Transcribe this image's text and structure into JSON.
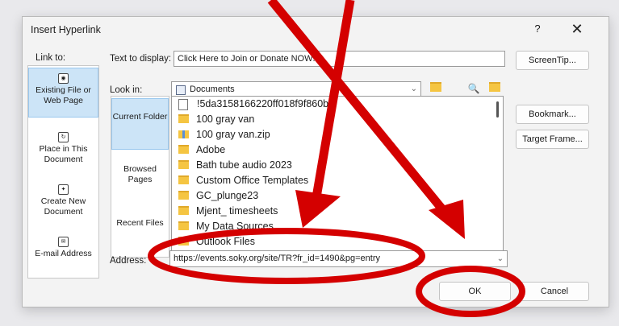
{
  "dialog": {
    "title": "Insert Hyperlink",
    "help": "?",
    "close": "✕"
  },
  "link_to": {
    "label": "Link to:",
    "items": [
      {
        "label": "Existing File or Web Page",
        "selected": true
      },
      {
        "label": "Place in This Document"
      },
      {
        "label": "Create New Document"
      },
      {
        "label": "E-mail Address"
      }
    ]
  },
  "text_to_display": {
    "label": "Text to display:",
    "value": "Click Here to Join or Donate NOW!"
  },
  "look_in": {
    "label": "Look in:",
    "value": "Documents"
  },
  "places": [
    {
      "label": "Current Folder",
      "selected": true
    },
    {
      "label": "Browsed Pages"
    },
    {
      "label": "Recent Files"
    }
  ],
  "files": [
    {
      "name": "!5da3158166220ff018f9f860b",
      "type": "file"
    },
    {
      "name": "100 gray van",
      "type": "folder"
    },
    {
      "name": "100 gray van.zip",
      "type": "zip"
    },
    {
      "name": "Adobe",
      "type": "folder"
    },
    {
      "name": "Bath tube audio 2023",
      "type": "folder"
    },
    {
      "name": "Custom Office Templates",
      "type": "folder"
    },
    {
      "name": "GC_plunge23",
      "type": "folder"
    },
    {
      "name": "Mjent_ timesheets",
      "type": "folder"
    },
    {
      "name": "My Data Sources",
      "type": "folder"
    },
    {
      "name": "Outlook Files",
      "type": "folder"
    }
  ],
  "address": {
    "label": "Address:",
    "value": "https://events.soky.org/site/TR?fr_id=1490&pg=entry"
  },
  "buttons": {
    "screentip": "ScreenTip...",
    "bookmark": "Bookmark...",
    "target_frame": "Target Frame...",
    "ok": "OK",
    "cancel": "Cancel"
  },
  "colors": {
    "annotation": "#d40000",
    "selection": "#cce4f7"
  }
}
